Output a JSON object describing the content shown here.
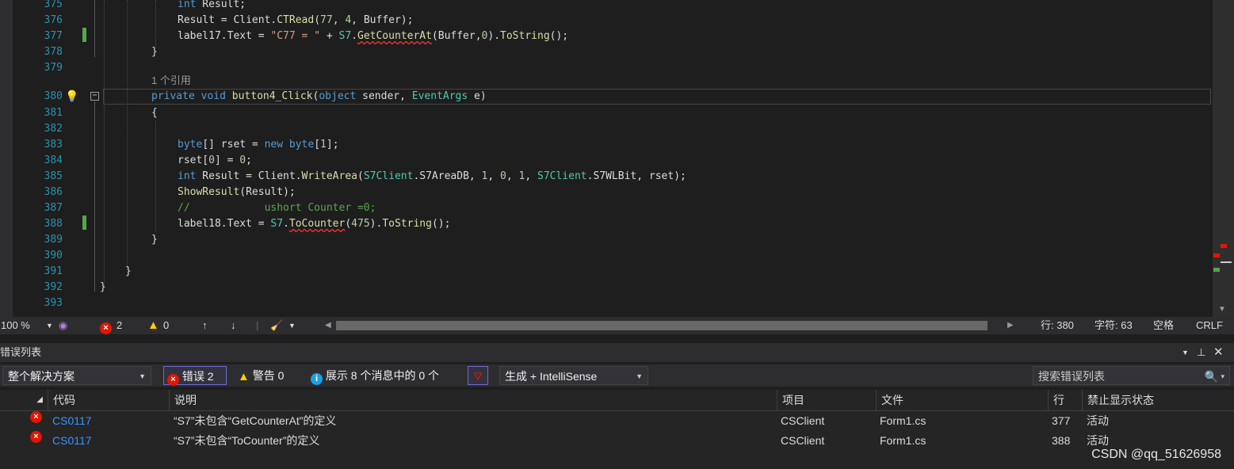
{
  "editor": {
    "ref_count_label": "1 个引用",
    "lines": [
      {
        "num": "375",
        "tokens": [
          {
            "t": "int",
            "c": "kw"
          },
          {
            "t": " Result;",
            "c": ""
          }
        ]
      },
      {
        "num": "376",
        "tokens": [
          {
            "t": "Result = Client.",
            "c": ""
          },
          {
            "t": "CTRead",
            "c": "fn"
          },
          {
            "t": "(",
            "c": ""
          },
          {
            "t": "77",
            "c": "num"
          },
          {
            "t": ", ",
            "c": ""
          },
          {
            "t": "4",
            "c": "num"
          },
          {
            "t": ", Buffer);",
            "c": ""
          }
        ]
      },
      {
        "num": "377",
        "tokens": [
          {
            "t": "label17.Text = ",
            "c": ""
          },
          {
            "t": "\"C77 = \"",
            "c": "str"
          },
          {
            "t": " + ",
            "c": ""
          },
          {
            "t": "S7",
            "c": "ty"
          },
          {
            "t": ".",
            "c": ""
          },
          {
            "t": "GetCounterAt",
            "c": "fn squig"
          },
          {
            "t": "(Buffer,",
            "c": ""
          },
          {
            "t": "0",
            "c": "num"
          },
          {
            "t": ").",
            "c": ""
          },
          {
            "t": "ToString",
            "c": "fn"
          },
          {
            "t": "();",
            "c": ""
          }
        ]
      },
      {
        "num": "378",
        "tokens": [
          {
            "t": "}",
            "c": ""
          }
        ]
      },
      {
        "num": "379",
        "tokens": []
      },
      {
        "num": "380",
        "tokens": [
          {
            "t": "private",
            "c": "kw"
          },
          {
            "t": " ",
            "c": ""
          },
          {
            "t": "void",
            "c": "kw"
          },
          {
            "t": " ",
            "c": ""
          },
          {
            "t": "button4_Click",
            "c": "fn"
          },
          {
            "t": "(",
            "c": ""
          },
          {
            "t": "object",
            "c": "kw"
          },
          {
            "t": " sender, ",
            "c": ""
          },
          {
            "t": "EventArgs",
            "c": "ty"
          },
          {
            "t": " e)",
            "c": ""
          }
        ]
      },
      {
        "num": "381",
        "tokens": [
          {
            "t": "{",
            "c": ""
          }
        ]
      },
      {
        "num": "382",
        "tokens": []
      },
      {
        "num": "383",
        "tokens": [
          {
            "t": "byte",
            "c": "kw"
          },
          {
            "t": "[] rset = ",
            "c": ""
          },
          {
            "t": "new",
            "c": "kw"
          },
          {
            "t": " ",
            "c": ""
          },
          {
            "t": "byte",
            "c": "kw"
          },
          {
            "t": "[",
            "c": ""
          },
          {
            "t": "1",
            "c": "num"
          },
          {
            "t": "];",
            "c": ""
          }
        ]
      },
      {
        "num": "384",
        "tokens": [
          {
            "t": "rset[",
            "c": ""
          },
          {
            "t": "0",
            "c": "num"
          },
          {
            "t": "] = ",
            "c": ""
          },
          {
            "t": "0",
            "c": "num"
          },
          {
            "t": ";",
            "c": ""
          }
        ]
      },
      {
        "num": "385",
        "tokens": [
          {
            "t": "int",
            "c": "kw"
          },
          {
            "t": " Result = Client.",
            "c": ""
          },
          {
            "t": "WriteArea",
            "c": "fn"
          },
          {
            "t": "(",
            "c": ""
          },
          {
            "t": "S7Client",
            "c": "ty"
          },
          {
            "t": ".S7AreaDB, ",
            "c": ""
          },
          {
            "t": "1",
            "c": "num"
          },
          {
            "t": ", ",
            "c": ""
          },
          {
            "t": "0",
            "c": "num"
          },
          {
            "t": ", ",
            "c": ""
          },
          {
            "t": "1",
            "c": "num"
          },
          {
            "t": ", ",
            "c": ""
          },
          {
            "t": "S7Client",
            "c": "ty"
          },
          {
            "t": ".S7WLBit, rset);",
            "c": ""
          }
        ]
      },
      {
        "num": "386",
        "tokens": [
          {
            "t": "ShowResult",
            "c": "fn"
          },
          {
            "t": "(Result);",
            "c": ""
          }
        ]
      },
      {
        "num": "387",
        "tokens": [
          {
            "t": "//            ushort Counter =0;",
            "c": "cm"
          }
        ]
      },
      {
        "num": "388",
        "tokens": [
          {
            "t": "label18.Text = ",
            "c": ""
          },
          {
            "t": "S7",
            "c": "ty"
          },
          {
            "t": ".",
            "c": ""
          },
          {
            "t": "ToCounter",
            "c": "fn squig"
          },
          {
            "t": "(",
            "c": ""
          },
          {
            "t": "475",
            "c": "num"
          },
          {
            "t": ").",
            "c": ""
          },
          {
            "t": "ToString",
            "c": "fn"
          },
          {
            "t": "();",
            "c": ""
          }
        ]
      },
      {
        "num": "389",
        "tokens": [
          {
            "t": "}",
            "c": ""
          }
        ]
      },
      {
        "num": "390",
        "tokens": []
      },
      {
        "num": "391",
        "tokens": [
          {
            "t": "}",
            "c": ""
          }
        ]
      },
      {
        "num": "392",
        "tokens": [
          {
            "t": "}",
            "c": ""
          }
        ]
      },
      {
        "num": "393",
        "tokens": []
      }
    ]
  },
  "statusbar": {
    "zoom": "100 %",
    "errors": "2",
    "warnings": "0",
    "line": "行: 380",
    "char": "字符: 63",
    "whitespace": "空格",
    "eol": "CRLF"
  },
  "error_list": {
    "title": "错误列表",
    "scope": "整个解决方案",
    "errors_button": "错误 2",
    "warnings_button": "警告 0",
    "messages_button": "展示 8 个消息中的 0 个",
    "build_filter": "生成 + IntelliSense",
    "search_placeholder": "搜索错误列表",
    "columns": {
      "code": "代码",
      "description": "说明",
      "project": "项目",
      "file": "文件",
      "line": "行",
      "suppression": "禁止显示状态"
    },
    "rows": [
      {
        "code": "CS0117",
        "description": "“S7”未包含“GetCounterAt”的定义",
        "project": "CSClient",
        "file": "Form1.cs",
        "line": "377",
        "suppression": "活动"
      },
      {
        "code": "CS0117",
        "description": "“S7”未包含“ToCounter”的定义",
        "project": "CSClient",
        "file": "Form1.cs",
        "line": "388",
        "suppression": "活动"
      }
    ]
  },
  "watermark": "CSDN @qq_51626958",
  "colors": {
    "keyword": "#569cd6",
    "type": "#4ec9b0",
    "method": "#dcdcaa",
    "number": "#b5cea8",
    "string": "#d69d85",
    "comment": "#57a64a",
    "line_number": "#2b91af",
    "error": "#e51400"
  }
}
